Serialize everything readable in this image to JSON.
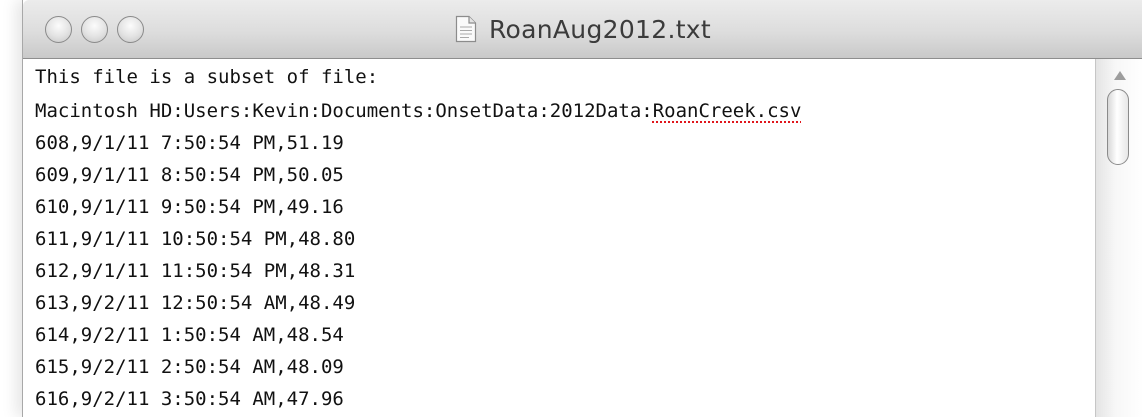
{
  "window": {
    "title": "RoanAug2012.txt",
    "title_icon": "document-icon"
  },
  "document": {
    "lines": [
      "This file is a subset of file:",
      "Macintosh HD:Users:Kevin:Documents:OnsetData:2012Data:",
      "608,9/1/11 7:50:54 PM,51.19",
      "609,9/1/11 8:50:54 PM,50.05",
      "610,9/1/11 9:50:54 PM,49.16",
      "611,9/1/11 10:50:54 PM,48.80",
      "612,9/1/11 11:50:54 PM,48.31",
      "613,9/2/11 12:50:54 AM,48.49",
      "614,9/2/11 1:50:54 AM,48.54",
      "615,9/2/11 2:50:54 AM,48.09",
      "616,9/2/11 3:50:54 AM,47.96"
    ],
    "misspelled_word": "RoanCreek.csv"
  },
  "colors": {
    "spellcheck_underline": "#e0161c"
  }
}
